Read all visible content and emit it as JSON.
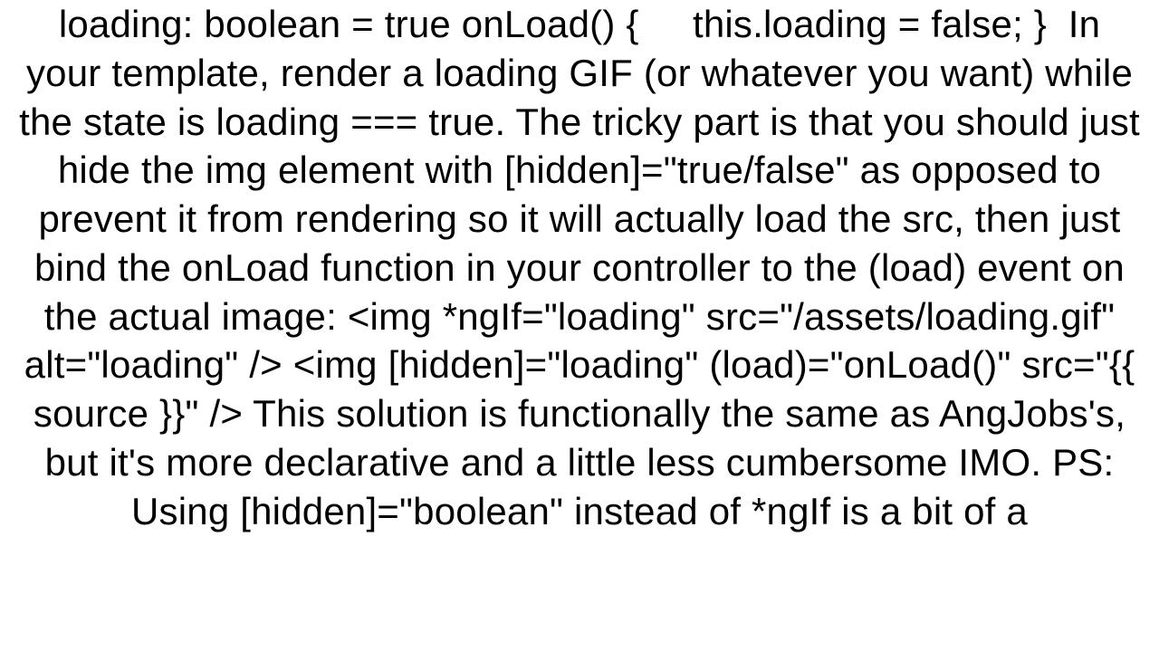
{
  "document": {
    "body": "loading: boolean = true onLoad() {     this.loading = false; }  In your template, render a loading GIF (or whatever you want) while the state is loading === true. The tricky part is that you should just hide the img element with [hidden]=\"true/false\" as opposed to prevent it from rendering so it will actually load the src, then just bind the onLoad function in your controller to the (load) event on the actual image: <img *ngIf=\"loading\" src=\"/assets/loading.gif\" alt=\"loading\" /> <img [hidden]=\"loading\" (load)=\"onLoad()\" src=\"{{ source }}\" /> This solution is functionally the same as AngJobs's, but it's more declarative and a little less cumbersome IMO. PS: Using [hidden]=\"boolean\" instead of *ngIf is a bit of a"
  }
}
